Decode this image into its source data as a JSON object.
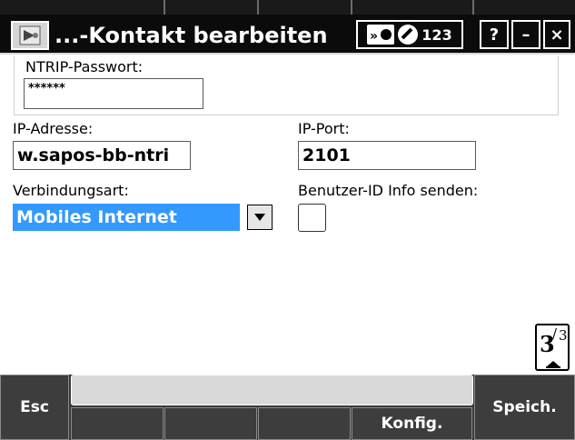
{
  "window": {
    "title": "...-Kontakt bearbeiten",
    "indicators": {
      "numeric_mode": "123"
    },
    "help_label": "?",
    "minimize_label": "–",
    "close_label": "×"
  },
  "form": {
    "ntrip_password": {
      "label": "NTRIP-Passwort:",
      "value": "******"
    },
    "ip_address": {
      "label": "IP-Adresse:",
      "value": "w.sapos-bb-ntri"
    },
    "ip_port": {
      "label": "IP-Port:",
      "value": "2101"
    },
    "connection_type": {
      "label": "Verbindungsart:",
      "value": "Mobiles Internet"
    },
    "send_user_id": {
      "label": "Benutzer-ID Info senden:",
      "checked": false
    },
    "page_indicator": {
      "current": "3",
      "total": "3"
    }
  },
  "toolbar": {
    "esc_label": "Esc",
    "config_label": "Konfig.",
    "save_label": "Speich."
  },
  "colors": {
    "selection": "#3399ff",
    "titlebar": "#0b0b0b",
    "toolbar": "#3a3a3a"
  }
}
